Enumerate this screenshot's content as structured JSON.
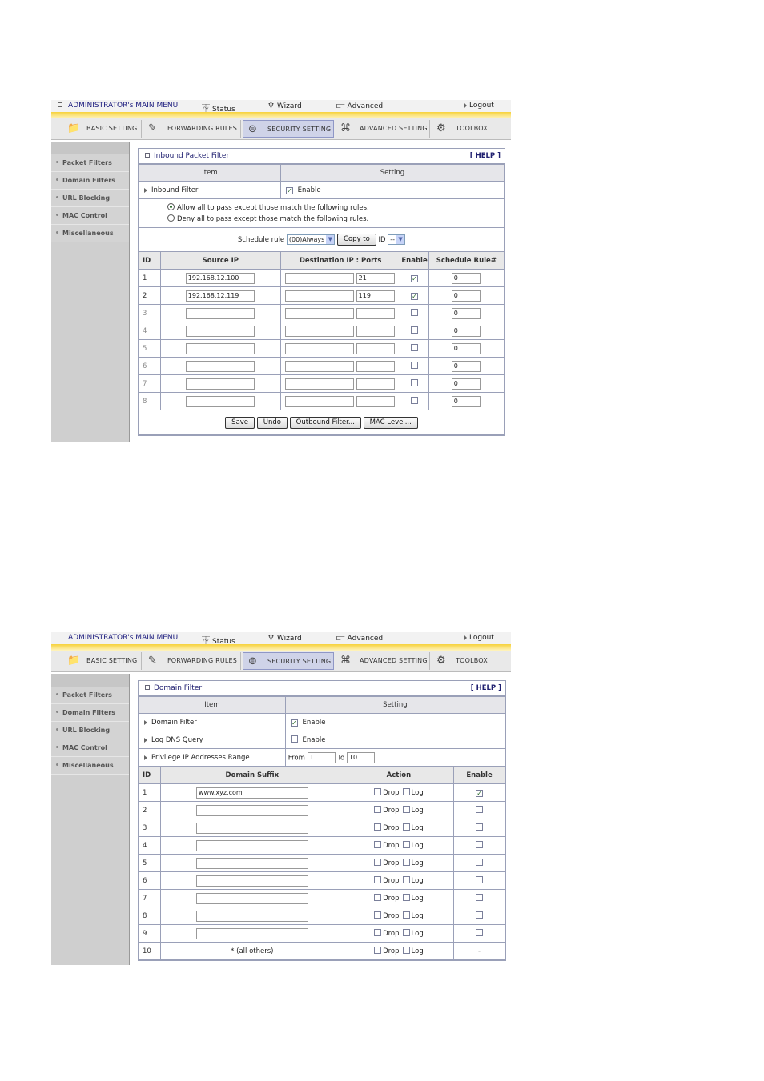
{
  "header": {
    "admin_label": "ADMINISTRATOR's MAIN MENU",
    "status_label": "Status",
    "wizard_label": "Wizard",
    "advanced_label": "Advanced",
    "logout_label": "Logout"
  },
  "tabs": [
    {
      "label": "BASIC SETTING",
      "icon": "basic-setting-icon"
    },
    {
      "label": "FORWARDING RULES",
      "icon": "forwarding-rules-icon"
    },
    {
      "label": "SECURITY SETTING",
      "icon": "security-setting-icon",
      "active": true
    },
    {
      "label": "ADVANCED SETTING",
      "icon": "advanced-setting-icon"
    },
    {
      "label": "TOOLBOX",
      "icon": "toolbox-icon"
    }
  ],
  "sidebar": {
    "items": [
      "Packet Filters",
      "Domain Filters",
      "URL Blocking",
      "MAC Control",
      "Miscellaneous"
    ]
  },
  "inbound": {
    "title": "Inbound Packet Filter",
    "help": "[ HELP ]",
    "col_item": "Item",
    "col_setting": "Setting",
    "filter_label": "Inbound Filter",
    "enable_label": "Enable",
    "filter_enabled": true,
    "radio_allow": "Allow all to pass except those match the following rules.",
    "radio_deny": "Deny all to pass except those match the following rules.",
    "schedule_label": "Schedule rule",
    "schedule_value": "(00)Always",
    "copy_button": "Copy to",
    "id_label": "ID",
    "id_value": "--",
    "col_id": "ID",
    "col_source": "Source IP",
    "col_dest": "Destination IP : Ports",
    "col_enable": "Enable",
    "col_schedule": "Schedule Rule#",
    "rows": [
      {
        "id": "1",
        "source": "192.168.12.100",
        "dest": "",
        "port": "21",
        "enabled": true,
        "rule": "0"
      },
      {
        "id": "2",
        "source": "192.168.12.119",
        "dest": "",
        "port": "119",
        "enabled": true,
        "rule": "0"
      },
      {
        "id": "3",
        "source": "",
        "dest": "",
        "port": "",
        "enabled": false,
        "rule": "0"
      },
      {
        "id": "4",
        "source": "",
        "dest": "",
        "port": "",
        "enabled": false,
        "rule": "0"
      },
      {
        "id": "5",
        "source": "",
        "dest": "",
        "port": "",
        "enabled": false,
        "rule": "0"
      },
      {
        "id": "6",
        "source": "",
        "dest": "",
        "port": "",
        "enabled": false,
        "rule": "0"
      },
      {
        "id": "7",
        "source": "",
        "dest": "",
        "port": "",
        "enabled": false,
        "rule": "0"
      },
      {
        "id": "8",
        "source": "",
        "dest": "",
        "port": "",
        "enabled": false,
        "rule": "0"
      }
    ],
    "buttons": [
      "Save",
      "Undo",
      "Outbound Filter...",
      "MAC Level..."
    ]
  },
  "domain": {
    "title": "Domain Filter",
    "help": "[ HELP ]",
    "col_item": "Item",
    "col_setting": "Setting",
    "filter_label": "Domain Filter",
    "filter_enabled": true,
    "log_label": "Log DNS Query",
    "log_enabled": false,
    "enable_label": "Enable",
    "range_label": "Privilege IP Addresses Range",
    "from_label": "From",
    "from_value": "1",
    "to_label": "To",
    "to_value": "10",
    "col_id": "ID",
    "col_suffix": "Domain Suffix",
    "col_action": "Action",
    "col_enable": "Enable",
    "drop_label": "Drop",
    "log_action_label": "Log",
    "rows": [
      {
        "id": "1",
        "suffix": "www.xyz.com",
        "enabled": true
      },
      {
        "id": "2",
        "suffix": "",
        "enabled": false
      },
      {
        "id": "3",
        "suffix": "",
        "enabled": false
      },
      {
        "id": "4",
        "suffix": "",
        "enabled": false
      },
      {
        "id": "5",
        "suffix": "",
        "enabled": false
      },
      {
        "id": "6",
        "suffix": "",
        "enabled": false
      },
      {
        "id": "7",
        "suffix": "",
        "enabled": false
      },
      {
        "id": "8",
        "suffix": "",
        "enabled": false
      },
      {
        "id": "9",
        "suffix": "",
        "enabled": false
      }
    ],
    "last_row": {
      "id": "10",
      "suffix": "* (all others)",
      "enable": "-"
    }
  }
}
